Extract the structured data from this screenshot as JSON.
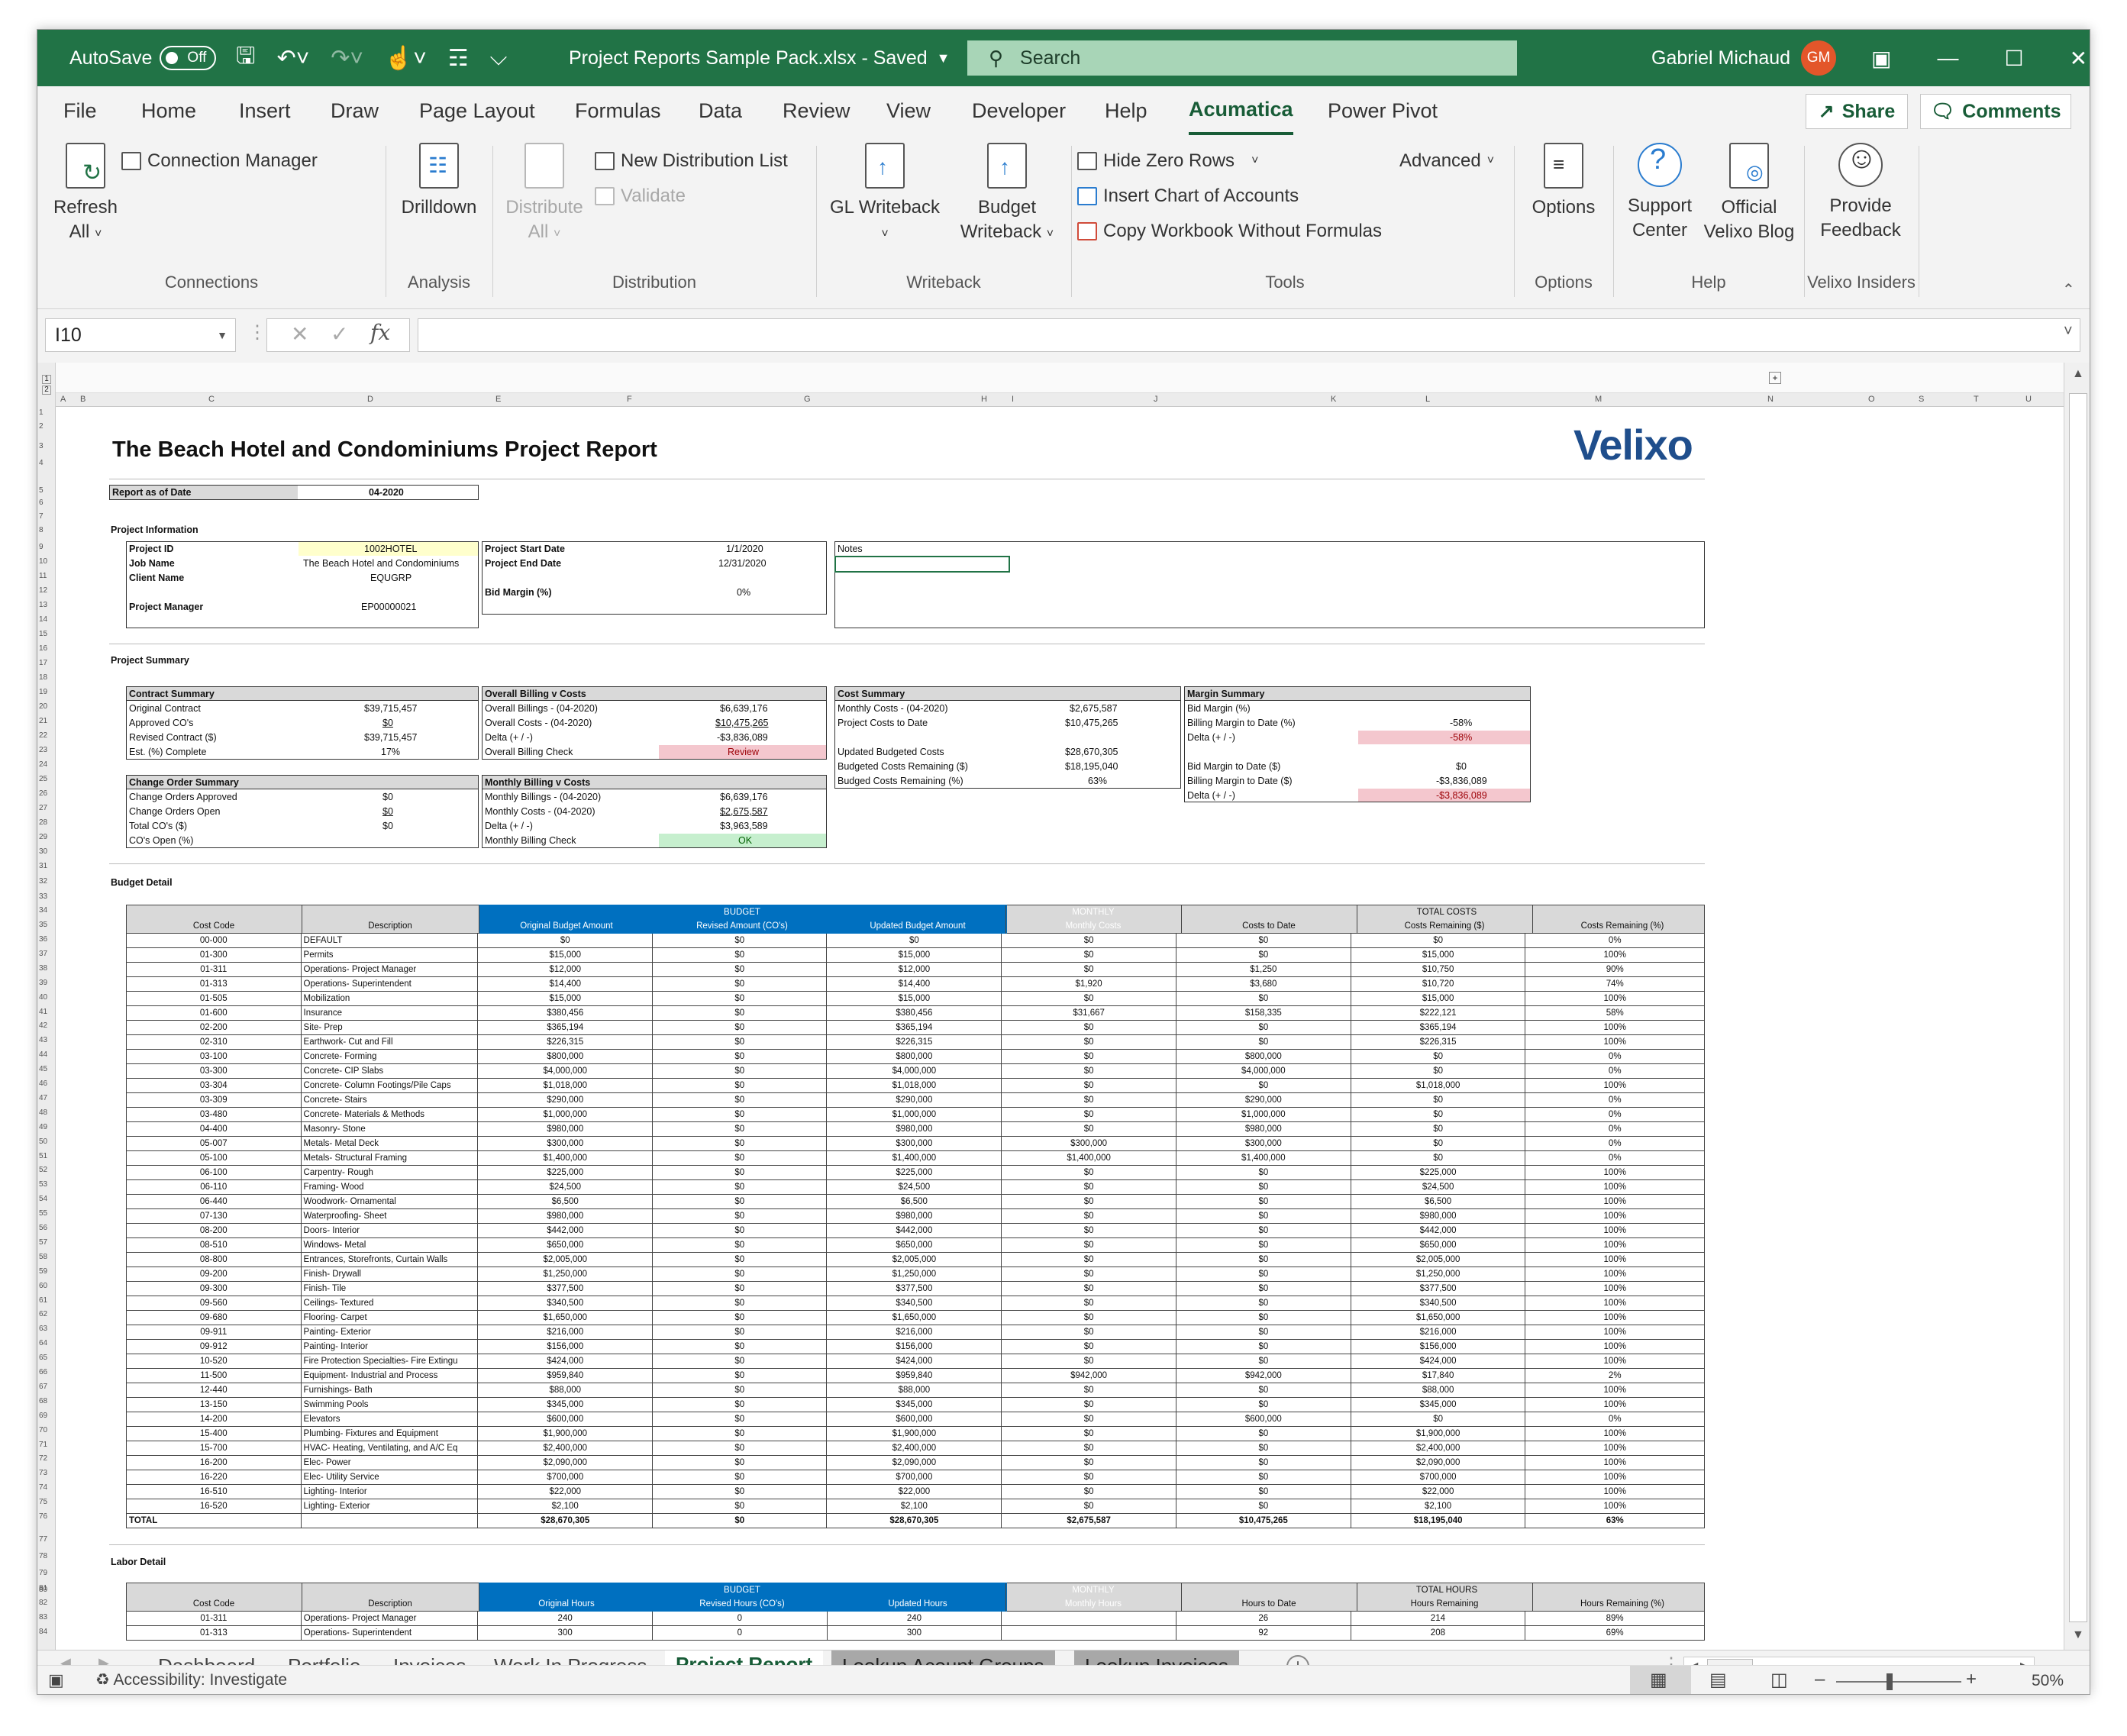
{
  "titlebar": {
    "autosave": "AutoSave",
    "autosave_state": "Off",
    "doc_title": "Project Reports Sample Pack.xlsx  -  Saved",
    "search_placeholder": "Search",
    "user_name": "Gabriel Michaud",
    "user_initials": "GM"
  },
  "menu": {
    "tabs": [
      "File",
      "Home",
      "Insert",
      "Draw",
      "Page Layout",
      "Formulas",
      "Data",
      "Review",
      "View",
      "Developer",
      "Help",
      "Acumatica",
      "Power Pivot"
    ],
    "share": "Share",
    "comments": "Comments"
  },
  "ribbon": {
    "refresh": "Refresh",
    "refresh2": "All",
    "connection_manager": "Connection Manager",
    "g_connections": "Connections",
    "drilldown": "Drilldown",
    "g_analysis": "Analysis",
    "distribute": "Distribute",
    "distribute2": "All",
    "new_distribution_list": "New Distribution List",
    "validate": "Validate",
    "g_distribution": "Distribution",
    "gl_writeback": "GL Writeback",
    "budget": "Budget",
    "writeback": "Writeback",
    "g_writeback": "Writeback",
    "hide_zero_rows": "Hide Zero Rows",
    "insert_chart": "Insert Chart of Accounts",
    "copy_workbook": "Copy Workbook Without Formulas",
    "advanced": "Advanced",
    "g_tools": "Tools",
    "options": "Options",
    "g_options": "Options",
    "support": "Support",
    "center": "Center",
    "official": "Official",
    "velixo_blog": "Velixo Blog",
    "g_help": "Help",
    "provide": "Provide",
    "feedback": "Feedback",
    "g_insiders": "Velixo Insiders"
  },
  "formula_bar": {
    "cell": "I10",
    "value": ""
  },
  "sheet": {
    "title": "The Beach Hotel and Condominiums Project Report",
    "logo": "Velixo",
    "report_as_of_label": "Report as of Date",
    "report_as_of": "04-2020",
    "project_info_heading": "Project Information",
    "pi": {
      "project_id_l": "Project ID",
      "project_id": "1002HOTEL",
      "job_name_l": "Job Name",
      "job_name": "The Beach Hotel and Condominiums",
      "client_name_l": "Client Name",
      "client_name": "EQUGRP",
      "pm_l": "Project Manager",
      "pm": "EP00000021",
      "start_l": "Project Start Date",
      "start": "1/1/2020",
      "end_l": "Project End Date",
      "end": "12/31/2020",
      "bid_l": "Bid Margin (%)",
      "bid": "0%",
      "notes_l": "Notes"
    },
    "summary_heading": "Project Summary",
    "cs": {
      "h": "Contract Summary",
      "r1l": "Original Contract",
      "r1": "$39,715,457",
      "r2l": "Approved CO's",
      "r2": "$0",
      "r3l": "Revised Contract ($)",
      "r3": "$39,715,457",
      "r4l": "Est. (%) Complete",
      "r4": "17%"
    },
    "cos": {
      "h": "Change Order Summary",
      "r1l": "Change Orders Approved",
      "r1": "$0",
      "r2l": "Change Orders Open",
      "r2": "$0",
      "r3l": "Total CO's ($)",
      "r3": "$0",
      "r4l": "CO's Open (%)",
      "r4": ""
    },
    "ob": {
      "h": "Overall Billing v Costs",
      "r1l": "Overall Billings - (04-2020)",
      "r1": "$6,639,176",
      "r2l": "Overall Costs - (04-2020)",
      "r2": "$10,475,265",
      "r3l": "Delta (+ / -)",
      "r3": "-$3,836,089",
      "r4l": "Overall Billing Check",
      "r4": "Review"
    },
    "mb": {
      "h": "Monthly Billing v Costs",
      "r1l": "Monthly Billings - (04-2020)",
      "r1": "$6,639,176",
      "r2l": "Monthly Costs - (04-2020)",
      "r2": "$2,675,587",
      "r3l": "Delta (+ / -)",
      "r3": "$3,963,589",
      "r4l": "Monthly Billing Check",
      "r4": "OK"
    },
    "cst": {
      "h": "Cost Summary",
      "r1l": "Monthly Costs - (04-2020)",
      "r1": "$2,675,587",
      "r2l": "Project Costs to Date",
      "r2": "$10,475,265",
      "r3l": "Updated Budgeted Costs",
      "r3": "$28,670,305",
      "r4l": "Budgeted Costs Remaining ($)",
      "r4": "$18,195,040",
      "r5l": "Budged Costs Remaining (%)",
      "r5": "63%"
    },
    "ms": {
      "h": "Margin Summary",
      "r1l": "Bid Margin (%)",
      "r1": "",
      "r2l": "Billing Margin to Date (%)",
      "r2": "-58%",
      "r3l": "Delta (+ / -)",
      "r3": "-58%",
      "r4l": "Bid Margin to Date ($)",
      "r4": "$0",
      "r5l": "Billing Margin to Date ($)",
      "r5": "-$3,836,089",
      "r6l": "Delta (+ / -)",
      "r6": "-$3,836,089"
    },
    "budget_heading": "Budget Detail",
    "budget_table": {
      "group_budget": "BUDGET",
      "group_monthly": "MONTHLY",
      "group_total": "TOTAL COSTS",
      "columns": [
        "Cost Code",
        "Description",
        "Original Budget Amount",
        "Revised Amount (CO's)",
        "Updated Budget Amount",
        "Monthly Costs",
        "Costs to Date",
        "Costs Remaining ($)",
        "Costs Remaining (%)"
      ],
      "rows": [
        [
          "00-000",
          "DEFAULT",
          "$0",
          "$0",
          "$0",
          "$0",
          "$0",
          "$0",
          "0%"
        ],
        [
          "01-300",
          "Permits",
          "$15,000",
          "$0",
          "$15,000",
          "$0",
          "$0",
          "$15,000",
          "100%"
        ],
        [
          "01-311",
          "Operations- Project Manager",
          "$12,000",
          "$0",
          "$12,000",
          "$0",
          "$1,250",
          "$10,750",
          "90%"
        ],
        [
          "01-313",
          "Operations- Superintendent",
          "$14,400",
          "$0",
          "$14,400",
          "$1,920",
          "$3,680",
          "$10,720",
          "74%"
        ],
        [
          "01-505",
          "Mobilization",
          "$15,000",
          "$0",
          "$15,000",
          "$0",
          "$0",
          "$15,000",
          "100%"
        ],
        [
          "01-600",
          "Insurance",
          "$380,456",
          "$0",
          "$380,456",
          "$31,667",
          "$158,335",
          "$222,121",
          "58%"
        ],
        [
          "02-200",
          "Site- Prep",
          "$365,194",
          "$0",
          "$365,194",
          "$0",
          "$0",
          "$365,194",
          "100%"
        ],
        [
          "02-310",
          "Earthwork- Cut and Fill",
          "$226,315",
          "$0",
          "$226,315",
          "$0",
          "$0",
          "$226,315",
          "100%"
        ],
        [
          "03-100",
          "Concrete- Forming",
          "$800,000",
          "$0",
          "$800,000",
          "$0",
          "$800,000",
          "$0",
          "0%"
        ],
        [
          "03-300",
          "Concrete- CIP Slabs",
          "$4,000,000",
          "$0",
          "$4,000,000",
          "$0",
          "$4,000,000",
          "$0",
          "0%"
        ],
        [
          "03-304",
          "Concrete- Column Footings/Pile Caps",
          "$1,018,000",
          "$0",
          "$1,018,000",
          "$0",
          "$0",
          "$1,018,000",
          "100%"
        ],
        [
          "03-309",
          "Concrete- Stairs",
          "$290,000",
          "$0",
          "$290,000",
          "$0",
          "$290,000",
          "$0",
          "0%"
        ],
        [
          "03-480",
          "Concrete- Materials & Methods",
          "$1,000,000",
          "$0",
          "$1,000,000",
          "$0",
          "$1,000,000",
          "$0",
          "0%"
        ],
        [
          "04-400",
          "Masonry- Stone",
          "$980,000",
          "$0",
          "$980,000",
          "$0",
          "$980,000",
          "$0",
          "0%"
        ],
        [
          "05-007",
          "Metals- Metal Deck",
          "$300,000",
          "$0",
          "$300,000",
          "$300,000",
          "$300,000",
          "$0",
          "0%"
        ],
        [
          "05-100",
          "Metals- Structural Framing",
          "$1,400,000",
          "$0",
          "$1,400,000",
          "$1,400,000",
          "$1,400,000",
          "$0",
          "0%"
        ],
        [
          "06-100",
          "Carpentry- Rough",
          "$225,000",
          "$0",
          "$225,000",
          "$0",
          "$0",
          "$225,000",
          "100%"
        ],
        [
          "06-110",
          "Framing- Wood",
          "$24,500",
          "$0",
          "$24,500",
          "$0",
          "$0",
          "$24,500",
          "100%"
        ],
        [
          "06-440",
          "Woodwork- Ornamental",
          "$6,500",
          "$0",
          "$6,500",
          "$0",
          "$0",
          "$6,500",
          "100%"
        ],
        [
          "07-130",
          "Waterproofing- Sheet",
          "$980,000",
          "$0",
          "$980,000",
          "$0",
          "$0",
          "$980,000",
          "100%"
        ],
        [
          "08-200",
          "Doors- Interior",
          "$442,000",
          "$0",
          "$442,000",
          "$0",
          "$0",
          "$442,000",
          "100%"
        ],
        [
          "08-510",
          "Windows- Metal",
          "$650,000",
          "$0",
          "$650,000",
          "$0",
          "$0",
          "$650,000",
          "100%"
        ],
        [
          "08-800",
          "Entrances, Storefronts, Curtain Walls",
          "$2,005,000",
          "$0",
          "$2,005,000",
          "$0",
          "$0",
          "$2,005,000",
          "100%"
        ],
        [
          "09-200",
          "Finish- Drywall",
          "$1,250,000",
          "$0",
          "$1,250,000",
          "$0",
          "$0",
          "$1,250,000",
          "100%"
        ],
        [
          "09-300",
          "Finish- Tile",
          "$377,500",
          "$0",
          "$377,500",
          "$0",
          "$0",
          "$377,500",
          "100%"
        ],
        [
          "09-560",
          "Ceilings- Textured",
          "$340,500",
          "$0",
          "$340,500",
          "$0",
          "$0",
          "$340,500",
          "100%"
        ],
        [
          "09-680",
          "Flooring- Carpet",
          "$1,650,000",
          "$0",
          "$1,650,000",
          "$0",
          "$0",
          "$1,650,000",
          "100%"
        ],
        [
          "09-911",
          "Painting- Exterior",
          "$216,000",
          "$0",
          "$216,000",
          "$0",
          "$0",
          "$216,000",
          "100%"
        ],
        [
          "09-912",
          "Painting- Interior",
          "$156,000",
          "$0",
          "$156,000",
          "$0",
          "$0",
          "$156,000",
          "100%"
        ],
        [
          "10-520",
          "Fire Protection Specialties- Fire Extingu",
          "$424,000",
          "$0",
          "$424,000",
          "$0",
          "$0",
          "$424,000",
          "100%"
        ],
        [
          "11-500",
          "Equipment- Industrial and Process",
          "$959,840",
          "$0",
          "$959,840",
          "$942,000",
          "$942,000",
          "$17,840",
          "2%"
        ],
        [
          "12-440",
          "Furnishings- Bath",
          "$88,000",
          "$0",
          "$88,000",
          "$0",
          "$0",
          "$88,000",
          "100%"
        ],
        [
          "13-150",
          "Swimming Pools",
          "$345,000",
          "$0",
          "$345,000",
          "$0",
          "$0",
          "$345,000",
          "100%"
        ],
        [
          "14-200",
          "Elevators",
          "$600,000",
          "$0",
          "$600,000",
          "$0",
          "$600,000",
          "$0",
          "0%"
        ],
        [
          "15-400",
          "Plumbing- Fixtures and Equipment",
          "$1,900,000",
          "$0",
          "$1,900,000",
          "$0",
          "$0",
          "$1,900,000",
          "100%"
        ],
        [
          "15-700",
          "HVAC- Heating, Ventilating, and A/C Eq",
          "$2,400,000",
          "$0",
          "$2,400,000",
          "$0",
          "$0",
          "$2,400,000",
          "100%"
        ],
        [
          "16-200",
          "Elec- Power",
          "$2,090,000",
          "$0",
          "$2,090,000",
          "$0",
          "$0",
          "$2,090,000",
          "100%"
        ],
        [
          "16-220",
          "Elec- Utility Service",
          "$700,000",
          "$0",
          "$700,000",
          "$0",
          "$0",
          "$700,000",
          "100%"
        ],
        [
          "16-510",
          "Lighting- Interior",
          "$22,000",
          "$0",
          "$22,000",
          "$0",
          "$0",
          "$22,000",
          "100%"
        ],
        [
          "16-520",
          "Lighting- Exterior",
          "$2,100",
          "$0",
          "$2,100",
          "$0",
          "$0",
          "$2,100",
          "100%"
        ]
      ],
      "total": [
        "TOTAL",
        "",
        "$28,670,305",
        "$0",
        "$28,670,305",
        "$2,675,587",
        "$10,475,265",
        "$18,195,040",
        "63%"
      ]
    },
    "labor_heading": "Labor Detail",
    "labor_table": {
      "group_budget": "BUDGET",
      "group_monthly": "MONTHLY",
      "group_total": "TOTAL HOURS",
      "columns": [
        "Cost Code",
        "Description",
        "Original Hours",
        "Revised Hours (CO's)",
        "Updated Hours",
        "Monthly Hours",
        "Hours to Date",
        "Hours Remaining",
        "Hours Remaining (%)"
      ],
      "rows": [
        [
          "01-311",
          "Operations- Project Manager",
          "240",
          "0",
          "240",
          "",
          "26",
          "214",
          "89%"
        ],
        [
          "01-313",
          "Operations- Superintendent",
          "300",
          "0",
          "300",
          "",
          "92",
          "208",
          "69%"
        ]
      ]
    }
  },
  "sheet_tabs": [
    "Dashboard",
    "Portfolio",
    "Invoices",
    "Work In Progress",
    "Project Report",
    "Lookup Acount Groups",
    "Lookup Invoices"
  ],
  "status": {
    "accessibility": "Accessibility: Investigate",
    "zoom": "50%"
  },
  "colors": {
    "excel_green": "#217346",
    "budget_blue": "#0070c0",
    "review_red": "#f4c7ce",
    "ok_green": "#c6efce",
    "pm_yellow": "#ffffcc"
  }
}
